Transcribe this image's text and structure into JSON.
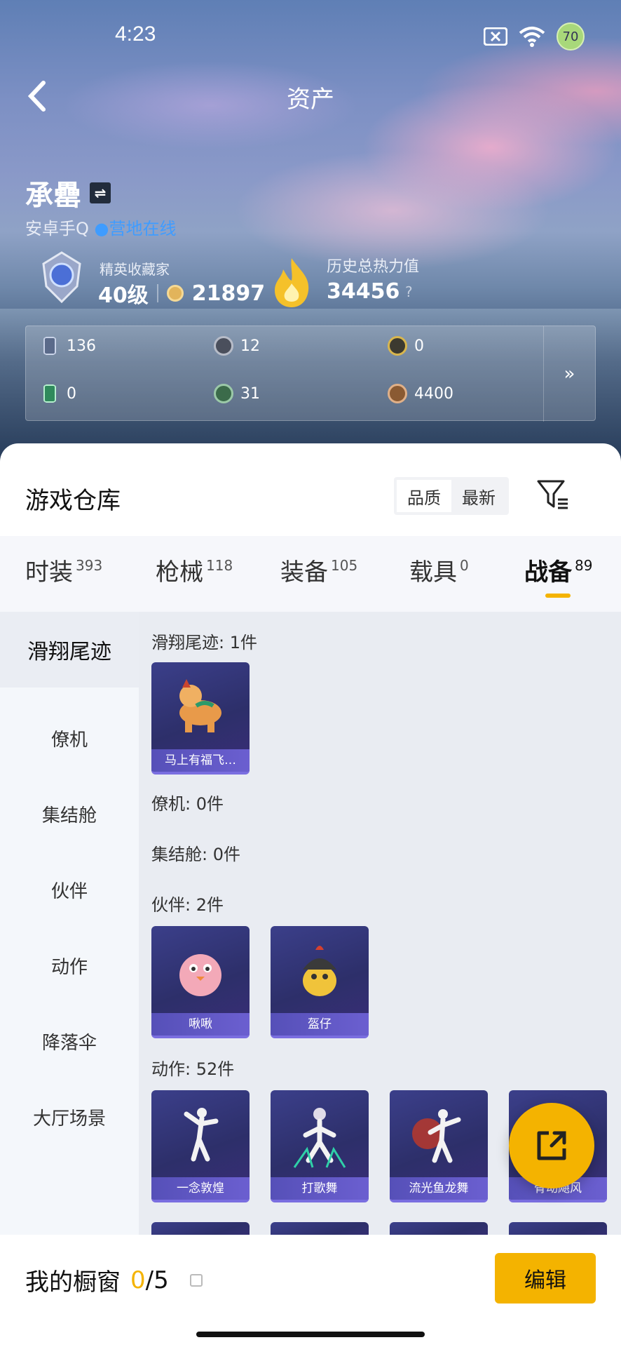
{
  "status_bar": {
    "time": "4:23",
    "battery": "70"
  },
  "header": {
    "title": "资产"
  },
  "profile": {
    "name": "承罍",
    "platform": "安卓手Q",
    "online_status": "营地在线",
    "collector_title": "精英收藏家",
    "level": "40级",
    "coins": "21897",
    "heat_label": "历史总热力值",
    "heat_value": "34456",
    "heat_help": "?"
  },
  "resources": [
    "136",
    "12",
    "0",
    "0",
    "31",
    "4400"
  ],
  "warehouse": {
    "title": "游戏仓库",
    "sort_options": [
      "品质",
      "最新"
    ],
    "tabs": [
      {
        "label": "时装",
        "count": "393"
      },
      {
        "label": "枪械",
        "count": "118"
      },
      {
        "label": "装备",
        "count": "105"
      },
      {
        "label": "载具",
        "count": "0"
      },
      {
        "label": "战备",
        "count": "89"
      }
    ]
  },
  "sidebar": [
    "滑翔尾迹",
    "僚机",
    "集结舱",
    "伙伴",
    "动作",
    "降落伞",
    "大厅场景"
  ],
  "sections": {
    "glide": {
      "title": "滑翔尾迹: 1件",
      "items": [
        "马上有福飞…"
      ]
    },
    "wingman": {
      "title": "僚机: 0件"
    },
    "capsule": {
      "title": "集结舱: 0件"
    },
    "partner": {
      "title": "伙伴: 2件",
      "items": [
        "啾啾",
        "盔仔"
      ]
    },
    "action": {
      "title": "动作: 52件",
      "items": [
        "一念敦煌",
        "打歌舞",
        "流光鱼龙舞",
        "骨动飓风"
      ]
    }
  },
  "showcase": {
    "label": "我的橱窗",
    "current": "0",
    "total": "/5",
    "edit_label": "编辑"
  }
}
